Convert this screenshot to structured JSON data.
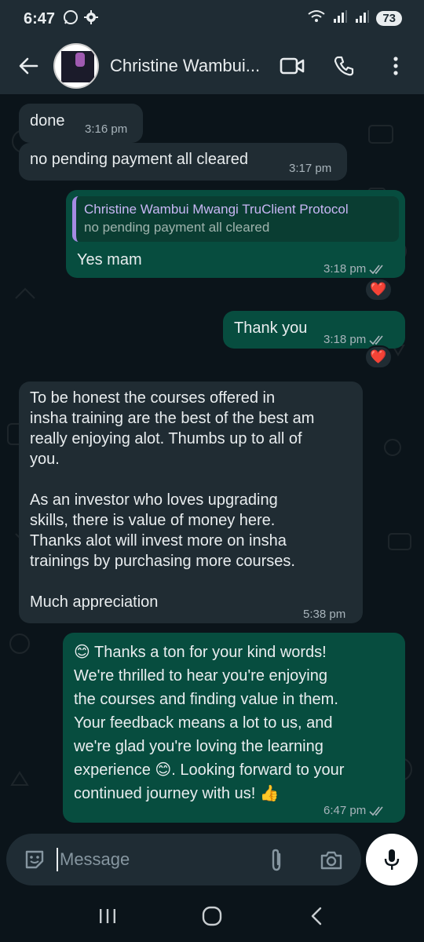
{
  "status_bar": {
    "time": "6:47",
    "battery": "73",
    "left_icons": [
      "whatsapp-icon",
      "gear-icon"
    ],
    "right_icons": [
      "wifi-icon",
      "signal-icon",
      "signal-icon"
    ]
  },
  "header": {
    "contact_name": "Christine Wambui...",
    "icons": [
      "back-arrow-icon",
      "video-call-icon",
      "phone-icon",
      "more-vert-icon"
    ]
  },
  "messages": [
    {
      "direction": "in",
      "text": "done",
      "time": "3:16 pm"
    },
    {
      "direction": "in",
      "text": "no pending payment all cleared",
      "time": "3:17 pm"
    },
    {
      "direction": "out",
      "quote_name": "Christine Wambui Mwangi TruClient Protocol",
      "quote_text": "no pending payment all cleared",
      "text": "Yes mam",
      "time": "3:18 pm",
      "reaction": "❤️"
    },
    {
      "direction": "out",
      "text": "Thank you",
      "time": "3:18 pm",
      "reaction": "❤️"
    },
    {
      "direction": "in",
      "lines": [
        "To be honest the courses offered in",
        "insha training are the best of the best am",
        "really enjoying alot. Thumbs up to all of",
        "you.",
        "",
        "As an investor who loves upgrading",
        "skills, there is value of money here.",
        "Thanks alot will invest more on insha",
        "trainings by purchasing more courses.",
        "",
        "Much appreciation"
      ],
      "time": "5:38 pm"
    },
    {
      "direction": "out",
      "lines": [
        "😊 Thanks a ton for your kind words!",
        "We're thrilled to hear you're enjoying",
        "the courses and finding value in them.",
        "Your feedback means a lot to us, and",
        "we're glad you're loving the learning",
        "experience 😊. Looking forward to your",
        "continued journey with us! 👍"
      ],
      "time": "6:47 pm"
    }
  ],
  "input": {
    "placeholder": "Message"
  },
  "colors": {
    "background": "#0b141a",
    "incoming_bubble": "#202c33",
    "outgoing_bubble": "#074d3f",
    "header": "#1f2c34",
    "quote_accent": "#a48ae3"
  }
}
